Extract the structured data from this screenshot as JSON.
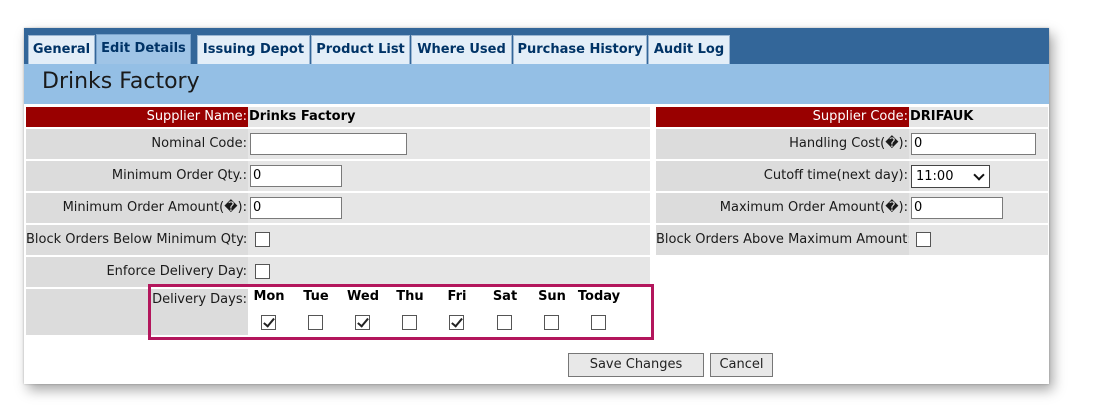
{
  "tabs": [
    {
      "label": "General"
    },
    {
      "label": "Edit Details",
      "active": true
    },
    {
      "label": "Issuing Depot"
    },
    {
      "label": "Product List"
    },
    {
      "label": "Where Used"
    },
    {
      "label": "Purchase History"
    },
    {
      "label": "Audit Log"
    }
  ],
  "page_title": "Drinks Factory",
  "left": {
    "supplier_name_label": "Supplier Name:",
    "supplier_name_value": "Drinks Factory",
    "nominal_code_label": "Nominal Code:",
    "nominal_code_value": "",
    "min_order_qty_label": "Minimum Order Qty.:",
    "min_order_qty_value": "0",
    "min_order_amount_label": "Minimum Order Amount(�):",
    "min_order_amount_value": "0",
    "block_below_label": "Block Orders Below Minimum Qty:",
    "block_below_checked": false,
    "enforce_delivery_label": "Enforce Delivery Day:",
    "enforce_delivery_checked": false,
    "delivery_days_label": "Delivery Days:",
    "delivery_days": [
      {
        "name": "Mon",
        "checked": true
      },
      {
        "name": "Tue",
        "checked": false
      },
      {
        "name": "Wed",
        "checked": true
      },
      {
        "name": "Thu",
        "checked": false
      },
      {
        "name": "Fri",
        "checked": true
      },
      {
        "name": "Sat",
        "checked": false
      },
      {
        "name": "Sun",
        "checked": false
      },
      {
        "name": "Today",
        "checked": false
      }
    ]
  },
  "right": {
    "supplier_code_label": "Supplier Code:",
    "supplier_code_value": "DRIFAUK",
    "handling_cost_label": "Handling Cost(�):",
    "handling_cost_value": "0",
    "cutoff_label": "Cutoff time(next day):",
    "cutoff_value": "11:00",
    "max_order_amount_label": "Maximum Order Amount(�):",
    "max_order_amount_value": "0",
    "block_above_label": "Block Orders Above Maximum Amount:",
    "block_above_checked": false
  },
  "buttons": {
    "save": "Save Changes",
    "cancel": "Cancel"
  },
  "colors": {
    "tab_bar": "#336699",
    "title_bar": "#94bfe5",
    "header_label": "#990000",
    "highlight_border": "#b3165c"
  }
}
